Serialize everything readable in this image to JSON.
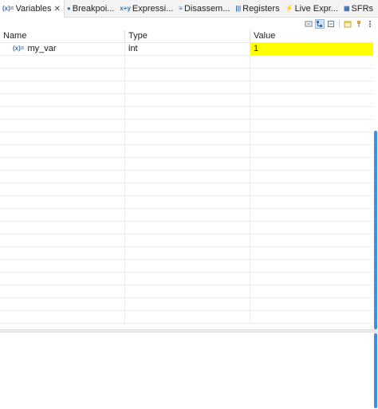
{
  "tabs": [
    {
      "icon": "(x)=",
      "label": "Variables",
      "active": true,
      "closable": true,
      "close_glyph": "✕"
    },
    {
      "icon": "●",
      "label": "Breakpoi..."
    },
    {
      "icon": "x+y",
      "label": "Expressi..."
    },
    {
      "icon": "≡",
      "label": "Disassem..."
    },
    {
      "icon": "|||",
      "label": "Registers"
    },
    {
      "icon": "⚡",
      "label": "Live Expr..."
    },
    {
      "icon": "▦",
      "label": "SFRs"
    }
  ],
  "toolbar": {
    "icons": [
      "show-type-names-icon",
      "show-logical-structure-icon",
      "collapse-all-icon",
      "new-view-icon",
      "pin-icon",
      "view-menu-icon"
    ]
  },
  "table": {
    "columns": [
      "Name",
      "Type",
      "Value"
    ],
    "rows": [
      {
        "name": "my_var",
        "type": "int",
        "value": "1",
        "value_changed": true
      }
    ],
    "empty_rows": 21
  },
  "colors": {
    "changed_value_bg": "#ffff00",
    "scrollbar": "#3b8fe6"
  }
}
